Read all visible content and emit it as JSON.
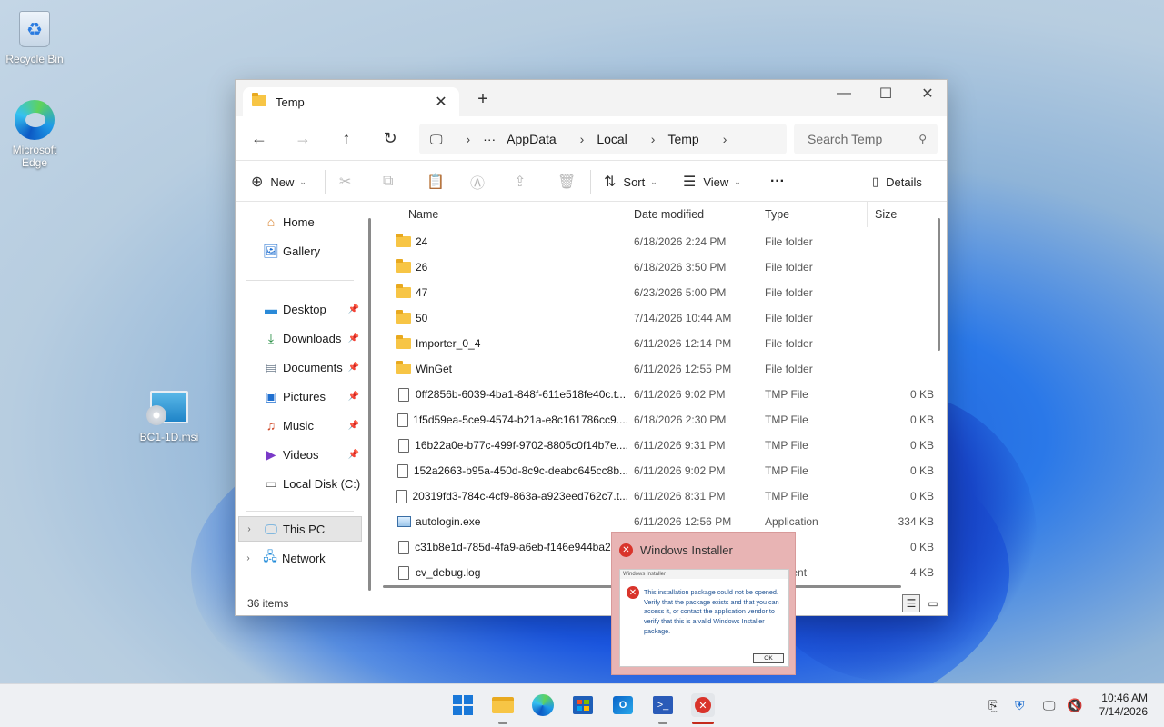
{
  "desktop": {
    "icons": [
      {
        "label": "Recycle Bin"
      },
      {
        "label": "Microsoft Edge"
      },
      {
        "label": "BC1-1D.msi"
      }
    ]
  },
  "explorer": {
    "tab_title": "Temp",
    "tab_close": "✕",
    "new_tab": "+",
    "window_controls": {
      "minimize": "—",
      "maximize": "☐",
      "close": "✕"
    },
    "nav": {
      "back": "←",
      "forward": "→",
      "up": "↑",
      "refresh": "↻"
    },
    "breadcrumb": [
      "AppData",
      "Local",
      "Temp"
    ],
    "breadcrumb_more": "···",
    "breadcrumb_sep": "›",
    "search_placeholder": "Search Temp",
    "toolbar": {
      "new_label": "New",
      "sort_label": "Sort",
      "view_label": "View",
      "more_label": "···",
      "details_label": "Details"
    },
    "sidebar": {
      "quick": [
        {
          "label": "Home"
        },
        {
          "label": "Gallery"
        }
      ],
      "pinned": [
        {
          "label": "Desktop"
        },
        {
          "label": "Downloads"
        },
        {
          "label": "Documents"
        },
        {
          "label": "Pictures"
        },
        {
          "label": "Music"
        },
        {
          "label": "Videos"
        },
        {
          "label": "Local Disk (C:)"
        }
      ],
      "roots": [
        {
          "label": "This PC",
          "selected": true
        },
        {
          "label": "Network",
          "selected": false
        }
      ]
    },
    "columns": {
      "name": "Name",
      "date": "Date modified",
      "type": "Type",
      "size": "Size"
    },
    "rows": [
      {
        "name": "24",
        "date": "6/18/2026 2:24 PM",
        "type": "File folder",
        "size": "",
        "kind": "folder"
      },
      {
        "name": "26",
        "date": "6/18/2026 3:50 PM",
        "type": "File folder",
        "size": "",
        "kind": "folder"
      },
      {
        "name": "47",
        "date": "6/23/2026 5:00 PM",
        "type": "File folder",
        "size": "",
        "kind": "folder"
      },
      {
        "name": "50",
        "date": "7/14/2026 10:44 AM",
        "type": "File folder",
        "size": "",
        "kind": "folder"
      },
      {
        "name": "Importer_0_4",
        "date": "6/11/2026 12:14 PM",
        "type": "File folder",
        "size": "",
        "kind": "folder"
      },
      {
        "name": "WinGet",
        "date": "6/11/2026 12:55 PM",
        "type": "File folder",
        "size": "",
        "kind": "folder"
      },
      {
        "name": "0ff2856b-6039-4ba1-848f-611e518fe40c.t...",
        "date": "6/11/2026 9:02 PM",
        "type": "TMP File",
        "size": "0 KB",
        "kind": "file"
      },
      {
        "name": "1f5d59ea-5ce9-4574-b21a-e8c161786cc9....",
        "date": "6/18/2026 2:30 PM",
        "type": "TMP File",
        "size": "0 KB",
        "kind": "file"
      },
      {
        "name": "16b22a0e-b77c-499f-9702-8805c0f14b7e....",
        "date": "6/11/2026 9:31 PM",
        "type": "TMP File",
        "size": "0 KB",
        "kind": "file"
      },
      {
        "name": "152a2663-b95a-450d-8c9c-deabc645cc8b...",
        "date": "6/11/2026 9:02 PM",
        "type": "TMP File",
        "size": "0 KB",
        "kind": "file"
      },
      {
        "name": "20319fd3-784c-4cf9-863a-a923eed762c7.t...",
        "date": "6/11/2026 8:31 PM",
        "type": "TMP File",
        "size": "0 KB",
        "kind": "file"
      },
      {
        "name": "autologin.exe",
        "date": "6/11/2026 12:56 PM",
        "type": "Application",
        "size": "334 KB",
        "kind": "app"
      },
      {
        "name": "c31b8e1d-785d-4fa9-a6eb-f146e944ba2c....",
        "date": "",
        "type": "ile",
        "size": "0 KB",
        "kind": "file"
      },
      {
        "name": "cv_debug.log",
        "date": "",
        "type": "ocument",
        "size": "4 KB",
        "kind": "file"
      }
    ],
    "status_count": "36 items"
  },
  "dialog": {
    "title": "Windows Installer",
    "inner_title": "Windows Installer",
    "message": "This installation package could not be opened.  Verify that the package exists and that you can access it, or contact the application vendor to verify that this is a valid Windows Installer package.",
    "ok_label": "OK"
  },
  "taskbar": {
    "apps": [
      "start-icon",
      "file-explorer-icon",
      "edge-icon",
      "store-icon",
      "outlook-icon",
      "powershell-icon",
      "error-app-icon"
    ],
    "time": "10:46 AM",
    "date": "7/14/2026"
  },
  "colors": {
    "accent": "#0067c0",
    "error": "#d9342b",
    "folder": "#f7c545"
  }
}
